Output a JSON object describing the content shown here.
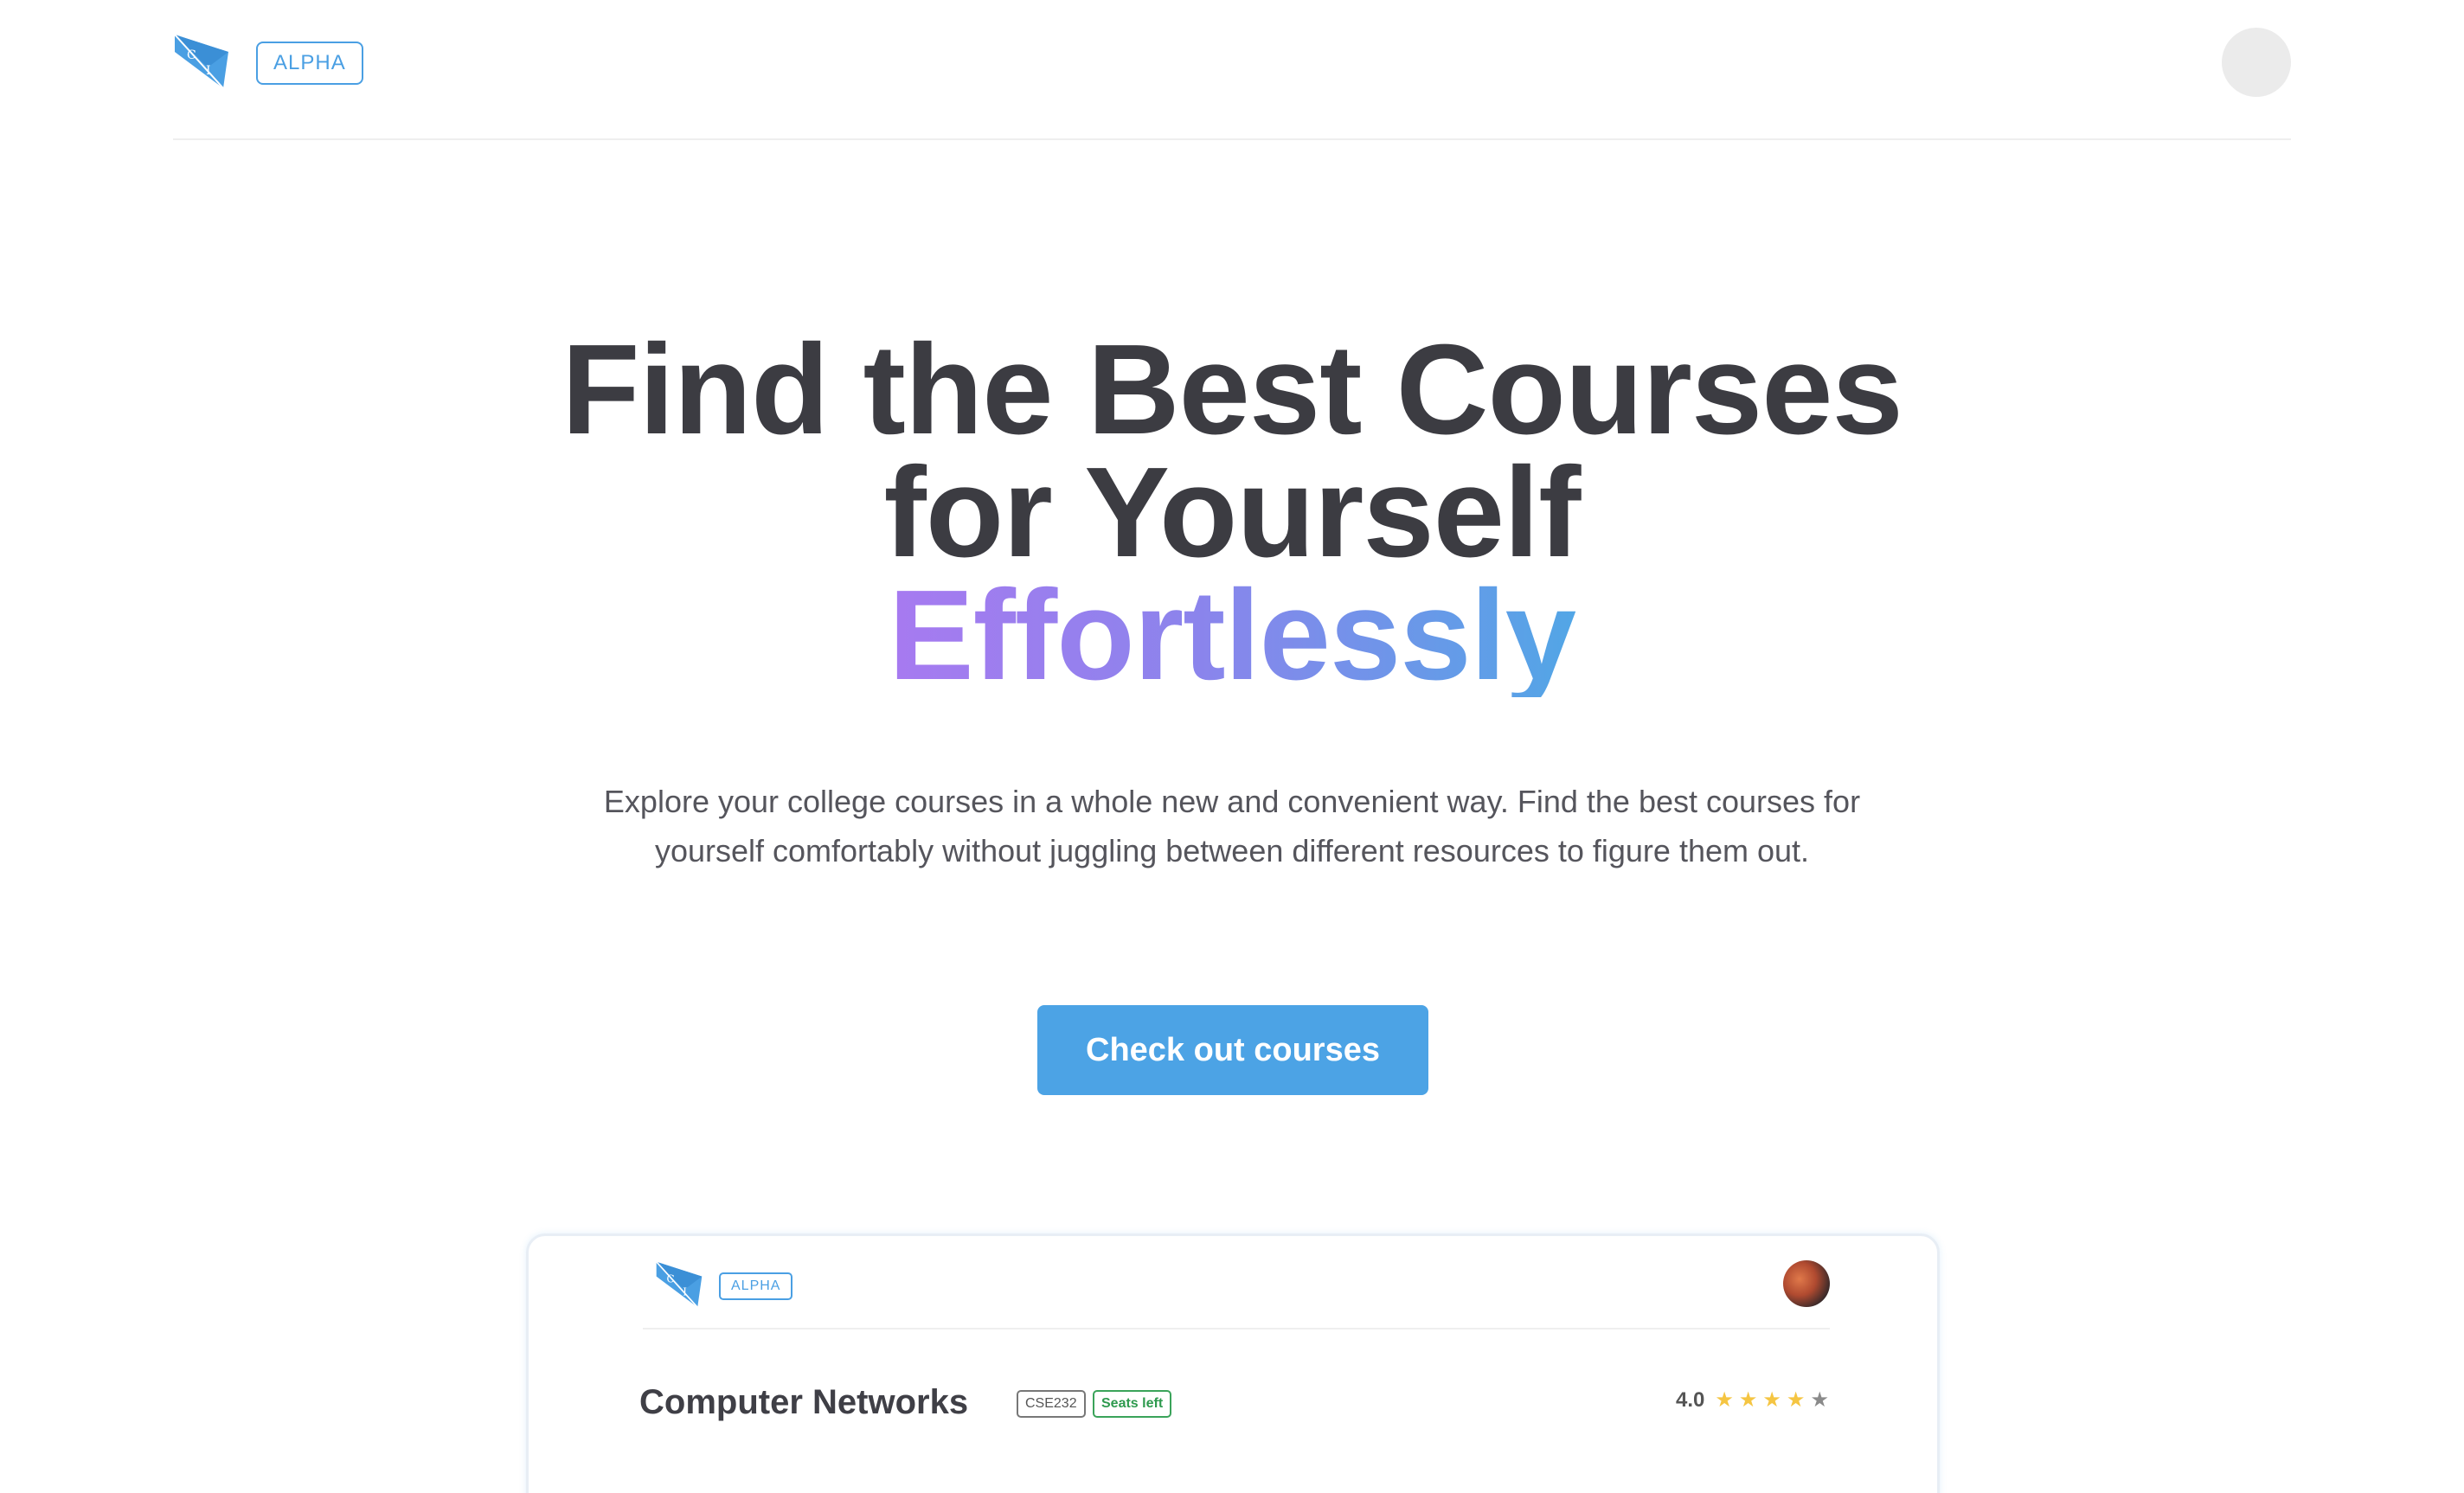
{
  "header": {
    "logo_letters": [
      "C",
      "I"
    ],
    "badge": "ALPHA"
  },
  "hero": {
    "title_line1": "Find the Best Courses",
    "title_line2": "for Yourself",
    "title_line3": "Effortlessly",
    "subtitle": "Explore your college courses in a whole new and convenient way. Find the best courses for yourself comfortably without juggling between different resources to figure them out.",
    "cta_label": "Check out courses"
  },
  "preview": {
    "badge": "ALPHA",
    "course": {
      "title": "Computer Networks",
      "code": "CSE232",
      "status": "Seats left",
      "rating": "4.0",
      "stars_filled": 4,
      "stars_total": 5
    }
  },
  "colors": {
    "accent": "#4ca3e5",
    "gradient_start": "#a77af0",
    "gradient_end": "#52a6e6",
    "star": "#f5c542",
    "success": "#2e9a4e"
  }
}
